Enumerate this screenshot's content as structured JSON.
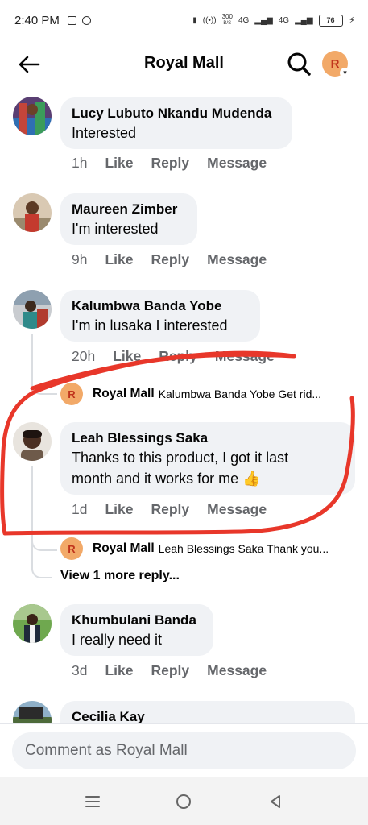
{
  "status_bar": {
    "time": "2:40 PM",
    "net_speed": "300",
    "net_unit": "B/S",
    "network_1": "4G",
    "network_2": "4G",
    "battery": "76"
  },
  "header": {
    "title": "Royal Mall",
    "avatar_initial": "R"
  },
  "comments": [
    {
      "author": "Lucy Lubuto Nkandu Mudenda",
      "text": "Interested",
      "time": "1h"
    },
    {
      "author": "Maureen Zimber",
      "text": "I'm interested",
      "time": "9h"
    },
    {
      "author": "Kalumbwa Banda Yobe",
      "text": "I'm in lusaka I interested",
      "time": "20h",
      "reply": {
        "initial": "R",
        "author": "Royal Mall",
        "preview": "Kalumbwa Banda Yobe  Get rid..."
      }
    },
    {
      "author": "Leah Blessings Saka",
      "text_line1": "Thanks to this product, I got it last",
      "text_line2": "month and it works for me 👍",
      "time": "1d",
      "reply": {
        "initial": "R",
        "author": "Royal Mall",
        "preview": "Leah Blessings Saka Thank you..."
      },
      "more_replies": "View 1 more reply..."
    },
    {
      "author": "Khumbulani Banda",
      "text": "I really need it",
      "time": "3d"
    },
    {
      "author": "Cecilia Kay"
    }
  ],
  "actions": {
    "like": "Like",
    "reply": "Reply",
    "message": "Message"
  },
  "composer": {
    "placeholder": "Comment as Royal Mall"
  },
  "colors": {
    "bubble": "#f0f2f5",
    "secondary_text": "#65676b",
    "brand_avatar": "#f2a968",
    "annotation_red": "#e8372a"
  }
}
